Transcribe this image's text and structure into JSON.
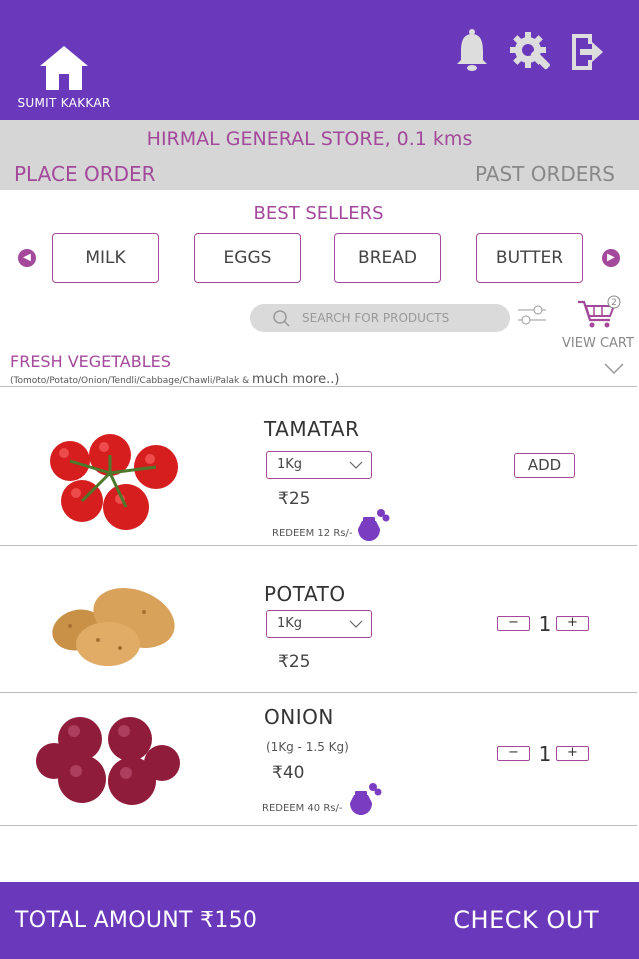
{
  "header": {
    "user_name": "SUMIT KAKKAR",
    "icons": [
      "home-icon",
      "bell-icon",
      "settings-wrench-icon",
      "logout-icon"
    ]
  },
  "store": {
    "name": "HIRMAL GENERAL STORE, 0.1 kms",
    "tab_place_order": "PLACE ORDER",
    "tab_past_orders": "PAST ORDERS"
  },
  "best_sellers": {
    "title": "BEST SELLERS",
    "items": [
      "MILK",
      "EGGS",
      "BREAD",
      "BUTTER"
    ]
  },
  "search": {
    "placeholder": "SEARCH FOR PRODUCTS"
  },
  "cart": {
    "label": "VIEW CART",
    "count": "2"
  },
  "category": {
    "title": "FRESH VEGETABLES",
    "subtitle": "(Tomoto/Potato/Onion/Tendli/Cabbage/Chawli/Palak &",
    "more": "much more..)"
  },
  "products": [
    {
      "name": "TAMATAR",
      "unit": "1Kg",
      "price": "₹25",
      "redeem": "REDEEM 12 Rs/-",
      "action": "ADD"
    },
    {
      "name": "POTATO",
      "unit": "1Kg",
      "price": "₹25",
      "qty": "1",
      "minus": "−",
      "plus": "+"
    },
    {
      "name": "ONION",
      "range": "(1Kg - 1.5 Kg)",
      "price": "₹40",
      "redeem": "REDEEM 40 Rs/-",
      "qty": "1",
      "minus": "−",
      "plus": "+"
    }
  ],
  "footer": {
    "total": "TOTAL AMOUNT ₹150",
    "checkout": "CHECK OUT"
  },
  "colors": {
    "primary": "#6a39bb",
    "accent": "#a3489b",
    "bar": "#d6d6d6"
  }
}
